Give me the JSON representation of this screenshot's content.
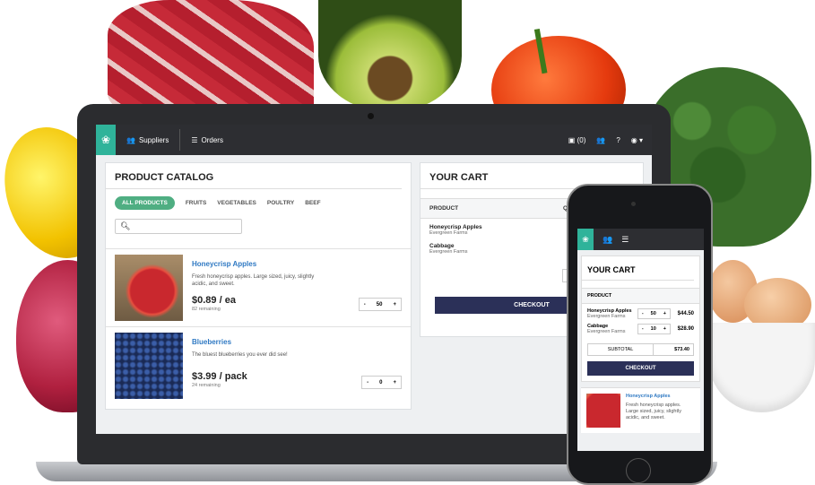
{
  "colors": {
    "accent": "#2fb39a",
    "filter_active": "#4fae82",
    "link": "#2f79c3",
    "checkout": "#2b3058",
    "topbar": "#2d2e32"
  },
  "nav": {
    "suppliers": "Suppliers",
    "orders": "Orders",
    "messages_count": "(0)"
  },
  "catalog": {
    "title": "PRODUCT CATALOG",
    "filters": [
      "ALL PRODUCTS",
      "FRUITS",
      "VEGETABLES",
      "POULTRY",
      "BEEF"
    ],
    "search_placeholder": "",
    "products": [
      {
        "name": "Honeycrisp Apples",
        "description": "Fresh honeycrisp apples. Large sized, juicy, slightly acidic, and sweet.",
        "price": "$0.89 / ea",
        "remaining": "82 remaining",
        "qty": "50"
      },
      {
        "name": "Blueberries",
        "description": "The bluest blueberries you ever did see!",
        "price": "$3.99 / pack",
        "remaining": "24 remaining",
        "qty": "0"
      }
    ]
  },
  "cart": {
    "title": "YOUR CART",
    "col_product": "PRODUCT",
    "col_qty": "QT",
    "items": [
      {
        "name": "Honeycrisp Apples",
        "farm": "Evergreen Farms",
        "qty": "50",
        "amount": "$44.50"
      },
      {
        "name": "Cabbage",
        "farm": "Evergreen Farms",
        "qty": "10",
        "amount": "$28.90"
      }
    ],
    "subtotal_label": "SUBTOTAL",
    "subtotal": "$73.40",
    "checkout": "CHECKOUT"
  },
  "stepper": {
    "minus": "-",
    "plus": "+"
  },
  "icons": {
    "logo": "leaf-logo-icon",
    "suppliers": "users-icon",
    "orders": "list-icon",
    "messages": "chat-icon",
    "team": "users-icon",
    "help": "help-icon",
    "account": "user-circle-icon",
    "search": "search-icon"
  }
}
